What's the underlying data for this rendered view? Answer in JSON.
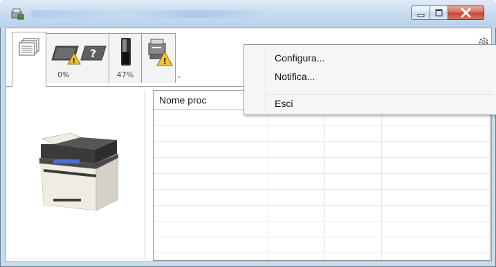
{
  "window": {
    "title": "",
    "minimize_label": "–",
    "maximize_label": "□",
    "close_label": "✕"
  },
  "tabs": [
    {
      "name": "print-jobs",
      "label": "",
      "icon": "document-stack-icon"
    },
    {
      "name": "paper",
      "label": "0%",
      "icon": "paper-tray-warning-icon"
    },
    {
      "name": "toner",
      "label": "47%",
      "icon": "toner-cartridge-icon"
    },
    {
      "name": "device",
      "label": "",
      "icon": "device-warning-icon"
    }
  ],
  "table": {
    "columns": [
      "Nome proc",
      "",
      "",
      ""
    ]
  },
  "context_menu": {
    "items": [
      "Configura...",
      "Notifica...",
      "Esci"
    ]
  },
  "colors": {
    "frame": "#c9dcee",
    "close_button": "#c1452f",
    "warning": "#f3c431"
  }
}
